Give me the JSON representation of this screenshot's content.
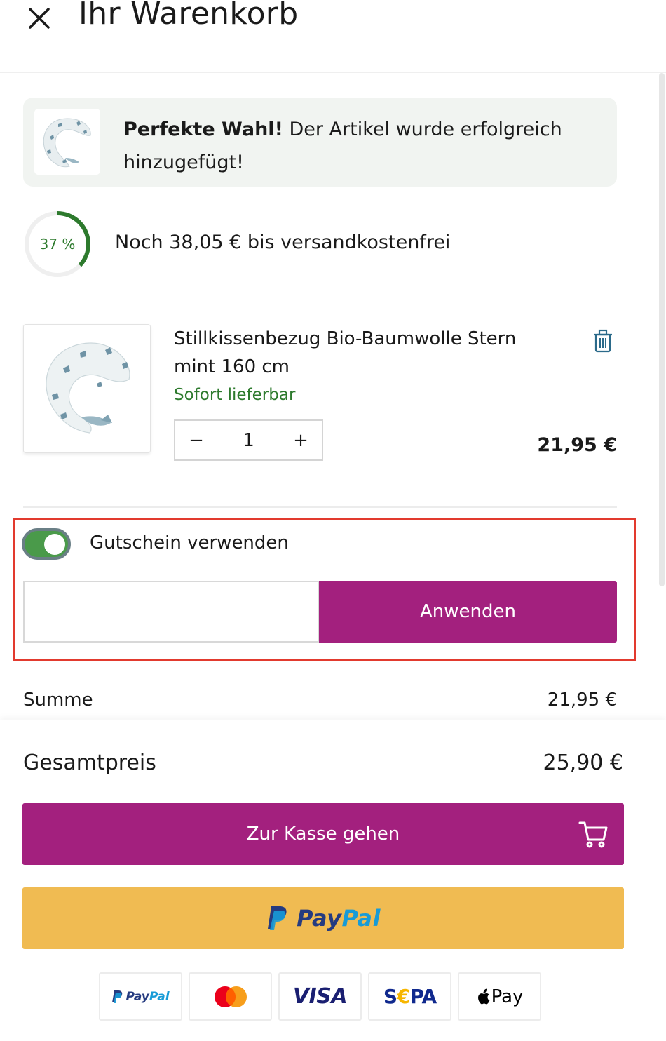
{
  "header": {
    "title": "Ihr Warenkorb",
    "close_icon": "close-icon"
  },
  "notice": {
    "bold": "Perfekte Wahl!",
    "text": " Der Artikel wurde erfolgreich hinzugefügt!"
  },
  "shipping": {
    "percent": 37,
    "percent_label": "37 %",
    "text": "Noch 38,05 € bis versandkostenfrei",
    "color": "#2d7a2d"
  },
  "product": {
    "name": "Stillkissenbezug Bio-Baumwolle Stern mint 160 cm",
    "stock": "Sofort lieferbar",
    "quantity": "1",
    "minus": "−",
    "plus": "+",
    "price": "21,95 €",
    "delete_icon": "trash-icon"
  },
  "coupon": {
    "toggle_on": true,
    "label": "Gutschein verwenden",
    "input_value": "",
    "apply_label": "Anwenden"
  },
  "summary": {
    "summe_label": "Summe",
    "summe_value": "21,95 €",
    "total_label": "Gesamtpreis",
    "total_value": "25,90 €"
  },
  "checkout": {
    "label": "Zur Kasse gehen",
    "icon": "cart-icon"
  },
  "paypal": {
    "pay": "Pay",
    "pal": "Pal"
  },
  "payment_methods": {
    "paypal": {
      "pay": "Pay",
      "pal": "Pal"
    },
    "mastercard": "mastercard-icon",
    "visa": "VISA",
    "sepa_s": "S",
    "sepa_e": "€",
    "sepa_pa": "PA",
    "applepay": "Pay"
  },
  "colors": {
    "accent": "#a3207e",
    "paypal_yellow": "#f0bb52",
    "success_green": "#2d7a2d",
    "highlight_red": "#e23a2e"
  }
}
